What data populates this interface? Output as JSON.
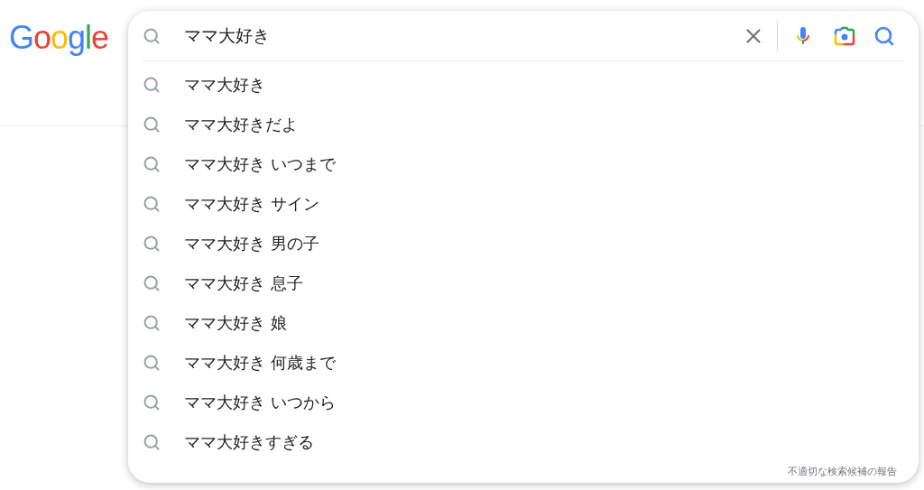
{
  "logo": "Google",
  "search": {
    "value": "ママ大好き"
  },
  "suggestions": [
    {
      "text": "ママ大好き"
    },
    {
      "text": "ママ大好きだよ"
    },
    {
      "text": "ママ大好き いつまで"
    },
    {
      "text": "ママ大好き サイン"
    },
    {
      "text": "ママ大好き 男の子"
    },
    {
      "text": "ママ大好き 息子"
    },
    {
      "text": "ママ大好き 娘"
    },
    {
      "text": "ママ大好き 何歳まで"
    },
    {
      "text": "ママ大好き いつから"
    },
    {
      "text": "ママ大好きすぎる"
    }
  ],
  "report_link": "不適切な検索候補の報告"
}
